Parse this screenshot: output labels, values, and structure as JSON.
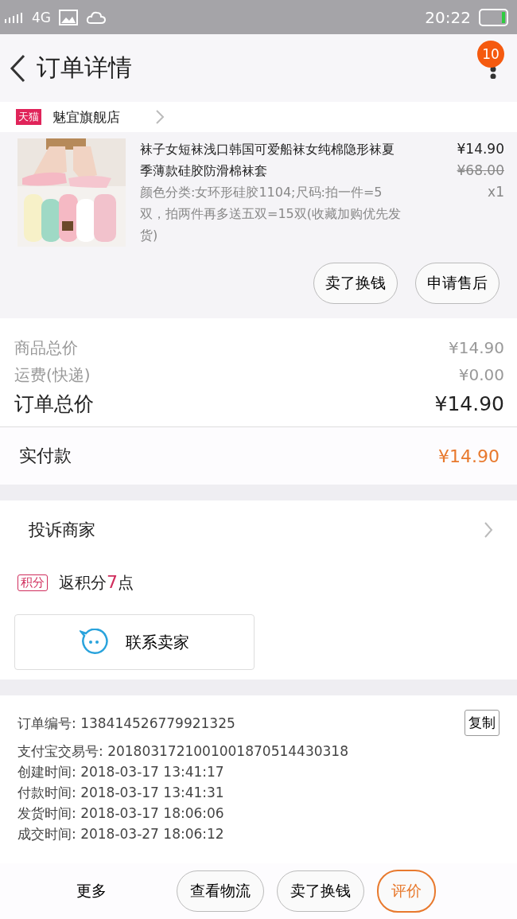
{
  "status_bar": {
    "network": "4G",
    "time": "20:22"
  },
  "header": {
    "title": "订单详情",
    "badge": "10"
  },
  "store": {
    "badge": "天猫",
    "name": "魅宜旗舰店"
  },
  "product": {
    "title": "袜子女短袜浅口韩国可爱船袜女纯棉隐形袜夏季薄款硅胶防滑棉袜套",
    "specs": "颜色分类:女环形硅胶1104;尺码:拍一件=5双，拍两件再多送五双=15双(收藏加购优先发货)",
    "price": "¥14.90",
    "original_price": "¥68.00",
    "quantity": "x1"
  },
  "item_actions": [
    "卖了换钱",
    "申请售后"
  ],
  "price_summary": [
    {
      "kind": "minor",
      "label": "商品总价",
      "value": "¥14.90"
    },
    {
      "kind": "minor",
      "label": "运费(快递)",
      "value": "¥0.00"
    },
    {
      "kind": "total",
      "label": "订单总价",
      "value": "¥14.90"
    }
  ],
  "paid": {
    "label": "实付款",
    "value": "¥14.90"
  },
  "complaint": {
    "label": "投诉商家"
  },
  "points": {
    "badge": "积分",
    "prefix": "返积分",
    "amount": "7",
    "suffix": "点"
  },
  "contact_button": "联系卖家",
  "order_info": {
    "number": "订单编号: 138414526779921325",
    "copy_button": "复制",
    "lines": [
      "支付宝交易号: 2018031721001001870514430318",
      "创建时间: 2018-03-17 13:41:17",
      "付款时间: 2018-03-17 13:41:31",
      "发货时间: 2018-03-17 18:06:06",
      "成交时间: 2018-03-27 18:06:12"
    ]
  },
  "bottom_bar": {
    "more": "更多",
    "buttons": [
      {
        "label": "查看物流",
        "highlighted": false
      },
      {
        "label": "卖了换钱",
        "highlighted": false
      },
      {
        "label": "评价",
        "highlighted": true
      }
    ]
  }
}
